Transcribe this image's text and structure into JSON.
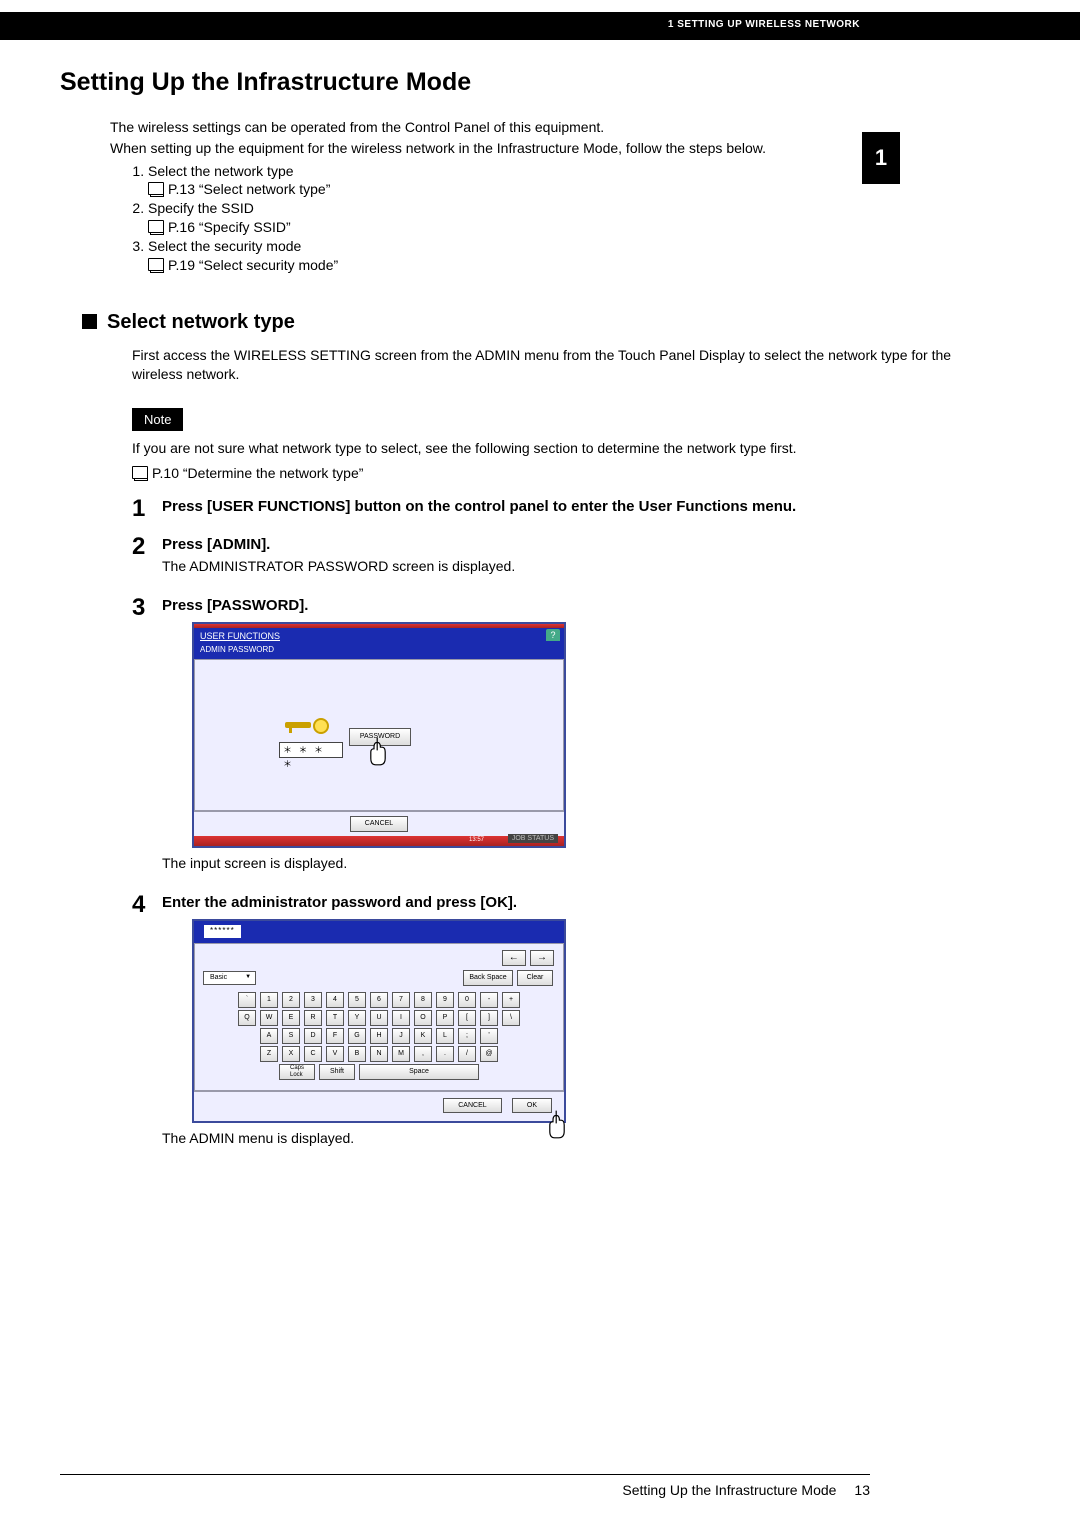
{
  "header": {
    "chapter_label": "1 SETTING UP WIRELESS NETWORK",
    "side_tab": "1"
  },
  "title": "Setting Up the Infrastructure Mode",
  "intro": {
    "line1": "The wireless settings can be operated from the Control Panel of this equipment.",
    "line2": "When setting up the equipment for the wireless network in the Infrastructure Mode, follow the steps below."
  },
  "toc": [
    {
      "text": "Select the network type",
      "ref": "P.13 “Select network type”"
    },
    {
      "text": "Specify the SSID",
      "ref": "P.16 “Specify SSID”"
    },
    {
      "text": "Select the security mode",
      "ref": "P.19 “Select security mode”"
    }
  ],
  "section_heading": "Select network type",
  "section_intro": "First access the WIRELESS SETTING screen from the ADMIN menu from the Touch Panel Display to select the network type for the wireless network.",
  "note_label": "Note",
  "note_text": "If you are not sure what network type to select, see the following section to determine the network type first.",
  "note_ref": "P.10 “Determine the network type”",
  "steps": [
    {
      "num": "1",
      "title": "Press [USER FUNCTIONS] button on the control panel to enter the User Functions menu.",
      "after": ""
    },
    {
      "num": "2",
      "title": "Press [ADMIN].",
      "after": "The ADMINISTRATOR PASSWORD screen is displayed."
    },
    {
      "num": "3",
      "title": "Press [PASSWORD].",
      "after": "The input screen is displayed."
    },
    {
      "num": "4",
      "title": "Enter the administrator password and press [OK].",
      "after": "The ADMIN menu is displayed."
    }
  ],
  "fig1": {
    "titlebar": "USER FUNCTIONS",
    "subbar": "ADMIN PASSWORD",
    "password_button": "PASSWORD",
    "password_mask": "＊ ＊ ＊ ＊",
    "cancel": "CANCEL",
    "job_status": "JOB STATUS",
    "time": "13:57",
    "help": "?"
  },
  "fig2": {
    "pw_display": "******",
    "arrow_left": "←",
    "arrow_right": "→",
    "mode": "Basic",
    "backspace": "Back Space",
    "clear": "Clear",
    "rows": {
      "r1": [
        "`",
        "1",
        "2",
        "3",
        "4",
        "5",
        "6",
        "7",
        "8",
        "9",
        "0",
        "-",
        "+"
      ],
      "r2": [
        "Q",
        "W",
        "E",
        "R",
        "T",
        "Y",
        "U",
        "I",
        "O",
        "P",
        "[",
        "]",
        "\\"
      ],
      "r3": [
        "A",
        "S",
        "D",
        "F",
        "G",
        "H",
        "J",
        "K",
        "L",
        ";",
        "'"
      ],
      "r4": [
        "Z",
        "X",
        "C",
        "V",
        "B",
        "N",
        "M",
        ",",
        ".",
        "/",
        "@"
      ]
    },
    "caps": "Caps\nLock",
    "shift": "Shift",
    "space": "Space",
    "cancel": "CANCEL",
    "ok": "OK"
  },
  "footer": {
    "title": "Setting Up the Infrastructure Mode",
    "page": "13"
  }
}
